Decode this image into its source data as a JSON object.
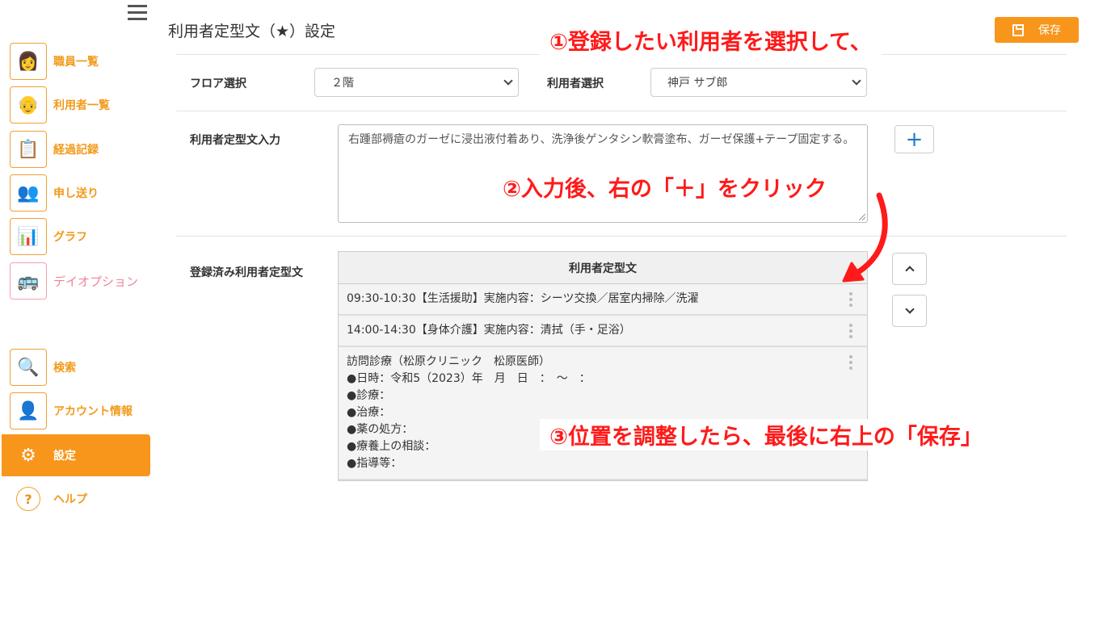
{
  "sidebar": {
    "items": [
      {
        "label": "職員一覧",
        "icon": "staff-icon",
        "glyph": "👩"
      },
      {
        "label": "利用者一覧",
        "icon": "user-icon",
        "glyph": "👴"
      },
      {
        "label": "経過記録",
        "icon": "clipboard-icon",
        "glyph": "📋"
      },
      {
        "label": "申し送り",
        "icon": "handover-icon",
        "glyph": "👥"
      },
      {
        "label": "グラフ",
        "icon": "graph-icon",
        "glyph": "📊"
      },
      {
        "label": "デイオプション",
        "icon": "bus-icon",
        "glyph": "🚌"
      },
      {
        "label": "検索",
        "icon": "search-icon",
        "glyph": "🔍"
      },
      {
        "label": "アカウント情報",
        "icon": "account-icon",
        "glyph": "👤"
      },
      {
        "label": "設定",
        "icon": "gear-icon",
        "glyph": "⚙"
      },
      {
        "label": "ヘルプ",
        "icon": "help-icon",
        "glyph": "?"
      }
    ]
  },
  "header": {
    "title": "利用者定型文（★）設定",
    "save_label": "保存"
  },
  "form": {
    "floor_label": "フロア選択",
    "floor_value": "２階",
    "user_label": "利用者選択",
    "user_value": "神戸 サブ郎",
    "template_input_label": "利用者定型文入力",
    "template_input_value": "右踵部褥瘡のガーゼに浸出液付着あり、洗浄後ゲンタシン軟膏塗布、ガーゼ保護+テープ固定する。",
    "plus_label": "+",
    "registered_label": "登録済み利用者定型文"
  },
  "table": {
    "header": "利用者定型文",
    "rows": [
      {
        "lines": [
          "09:30-10:30【生活援助】実施内容：シーツ交換／居室内掃除／洗濯"
        ]
      },
      {
        "lines": [
          "14:00-14:30【身体介護】実施内容：清拭（手・足浴）"
        ]
      },
      {
        "lines": [
          "訪問診療（松原クリニック　松原医師）",
          "●日時：令和5（2023）年　月　日　：　～　：",
          "●診療：",
          "●治療：",
          "●薬の処方：",
          "●療養上の相談：",
          "●指導等："
        ]
      }
    ]
  },
  "annotations": {
    "step1": "①登録したい利用者を選択して、",
    "step2": "②入力後、右の「＋」をクリック",
    "step3": "③位置を調整したら、最後に右上の「保存」"
  },
  "colors": {
    "accent": "#f7961b",
    "annotation": "#ff1a1a",
    "plus": "#1f78c8"
  }
}
